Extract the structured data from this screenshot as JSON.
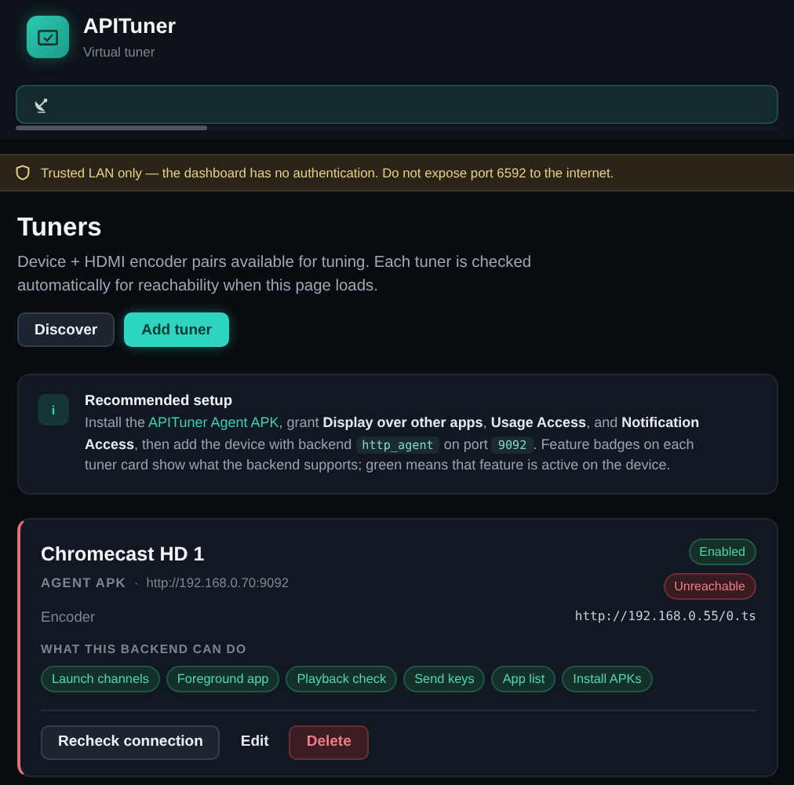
{
  "app": {
    "title": "APITuner",
    "subtitle": "Virtual tuner"
  },
  "status": {
    "level": 0.25
  },
  "warning": {
    "text": "Trusted LAN only — the dashboard has no authentication. Do not expose port 6592 to the internet."
  },
  "section": {
    "title": "Tuners",
    "description": "Device + HDMI encoder pairs available for tuning. Each tuner is checked automatically for reachability when this page loads."
  },
  "actions": [
    {
      "label": "Discover",
      "kind": "secondary"
    },
    {
      "label": "Add tuner",
      "kind": "primary"
    }
  ],
  "info": {
    "icon": "i",
    "title": "Recommended setup",
    "body": [
      {
        "kind": "text",
        "text": "Install the "
      },
      {
        "kind": "link",
        "text": "APITuner Agent APK"
      },
      {
        "kind": "text",
        "text": ", grant "
      },
      {
        "kind": "bold",
        "text": "Display over other apps"
      },
      {
        "kind": "text",
        "text": ", "
      },
      {
        "kind": "bold",
        "text": "Usage Access"
      },
      {
        "kind": "text",
        "text": ", and "
      },
      {
        "kind": "bold",
        "text": "Notification Access"
      },
      {
        "kind": "text",
        "text": ", then add the device with backend "
      },
      {
        "kind": "code",
        "text": "http_agent"
      },
      {
        "kind": "text",
        "text": " on port "
      },
      {
        "kind": "code",
        "text": "9092"
      },
      {
        "kind": "text",
        "text": ". Feature badges on each tuner card show what the backend supports; green means that feature is active on the device."
      }
    ]
  },
  "tuners": [
    {
      "name": "Chromecast HD 1",
      "backend": "AGENT APK",
      "separator": "·",
      "url": "http://192.168.0.70:9092",
      "reachable": false,
      "badges": [
        {
          "label": "Enabled",
          "kind": "success"
        },
        {
          "label": "Unreachable",
          "kind": "danger"
        }
      ],
      "encoder_label": "Encoder",
      "encoder_url": "http://192.168.0.55/0.ts",
      "features_title": "WHAT THIS BACKEND CAN DO",
      "features": [
        {
          "label": "Launch channels",
          "active": true
        },
        {
          "label": "Foreground app",
          "active": true
        },
        {
          "label": "Playback check",
          "active": true
        },
        {
          "label": "Send keys",
          "active": true
        },
        {
          "label": "App list",
          "active": true
        },
        {
          "label": "Install APKs",
          "active": true
        }
      ],
      "buttons": [
        {
          "label": "Recheck connection",
          "kind": "secondary"
        },
        {
          "label": "Edit",
          "kind": "plain"
        },
        {
          "label": "Delete",
          "kind": "danger"
        }
      ]
    }
  ]
}
